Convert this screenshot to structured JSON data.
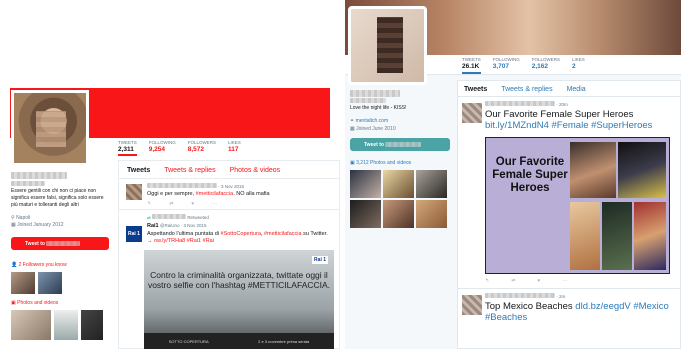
{
  "left": {
    "name": "Luca Maria",
    "bio": "Essere gentili con chi non ci piace non significa essere falsi, significa solo essere più maturi e tolleranti degli altri",
    "location": "Napoli",
    "joined": "Joined January 2012",
    "tweet_to": "Tweet to",
    "followers_know": "2 Followers you know",
    "photos_label": "Photos and videos",
    "stats": [
      {
        "label": "TWEETS",
        "value": "2,311"
      },
      {
        "label": "FOLLOWING",
        "value": "9,254"
      },
      {
        "label": "FOLLOWERS",
        "value": "8,572"
      },
      {
        "label": "LIKES",
        "value": "117"
      }
    ],
    "tabs": [
      "Tweets",
      "Tweets & replies",
      "Photos & videos"
    ],
    "tweet1": {
      "date": "· 3 Nov 2015",
      "text": "Oggi e per sempre, ",
      "hashtag": "#metticilafaccia",
      "text2": ". NO alla mafia"
    },
    "retweet": {
      "label": "Retweeted",
      "account": "Rai1",
      "handle": "@RaiUno · 3 Nov 2015",
      "text1": "Aspettando l'ultima puntata di ",
      "hash1": "#SottoCopertura",
      "text2": ", ",
      "hash2": "#metticilafaccia",
      "text3": " su Twitter. → ",
      "link": "ow.ly/TRHa8 #Rai1 #Rai",
      "media_caption": "Contro la criminalità organizzata, twittate oggi il vostro selfie con l'hashtag #METTICILAFACCIA.",
      "media_badge": "Rai 1",
      "media_bar": [
        "SOTTO COPERTURA",
        "2 e 3 novembre prima serata"
      ],
      "logo": "Rai 1"
    }
  },
  "right": {
    "bio": "Love the night life - KISS!",
    "link": "mentaltch.com",
    "joined": "Joined June 2010",
    "tweet_to": "Tweet to",
    "photos_label": "3,212 Photos and videos",
    "stats": [
      {
        "label": "TWEETS",
        "value": "26.1K"
      },
      {
        "label": "FOLLOWING",
        "value": "3,707"
      },
      {
        "label": "FOLLOWERS",
        "value": "2,162"
      },
      {
        "label": "LIKES",
        "value": "2"
      }
    ],
    "tabs": [
      "Tweets",
      "Tweets & replies",
      "Media"
    ],
    "tweet1": {
      "time": "· 20m",
      "title": "Our Favorite Female Super Heroes",
      "link": "bit.ly/1MZndN4 #Female #SuperHeroes",
      "poster": "Our Favorite Female Super Heroes"
    },
    "tweet2": {
      "time": "· 2m",
      "title": "Top Mexico Beaches ",
      "link": "dld.bz/eegdV #Mexico #Beaches"
    }
  },
  "colors": {
    "left_accent": "#f81619",
    "right_accent": "#2b7bb9",
    "right_button": "#4aa3a5"
  }
}
